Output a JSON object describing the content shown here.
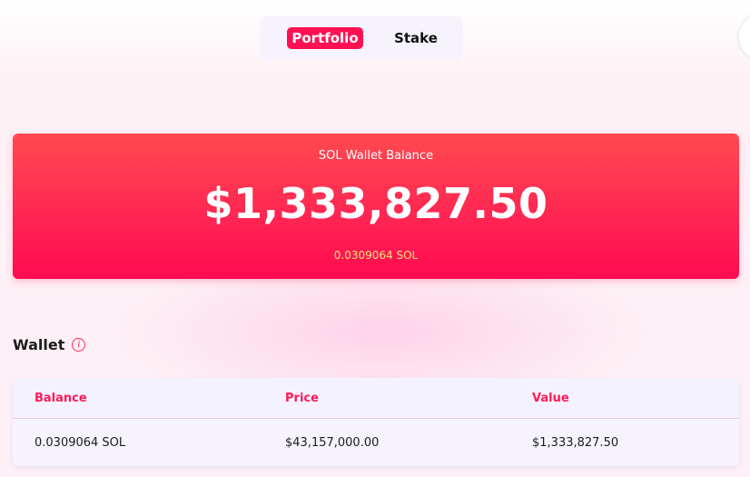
{
  "tabs": {
    "portfolio_label": "Portfolio",
    "stake_label": "Stake",
    "active": "Portfolio"
  },
  "balance": {
    "label": "SOL Wallet Balance",
    "amount": "$1,333,827.50",
    "sol_amount": "0.0309064 SOL"
  },
  "wallet": {
    "title": "Wallet",
    "info_icon": "info-icon",
    "columns": [
      "Balance",
      "Price",
      "Value"
    ],
    "rows": [
      {
        "balance": "0.0309064 SOL",
        "price": "$43,157,000.00",
        "value": "$1,333,827.50"
      }
    ]
  },
  "colors": {
    "accent": "#ff1154",
    "card_gradient_top": "#ff4a4f",
    "card_gradient_bottom": "#ff0a4f",
    "sol_text": "#f6e27a",
    "table_bg": "#f5f2ff"
  }
}
